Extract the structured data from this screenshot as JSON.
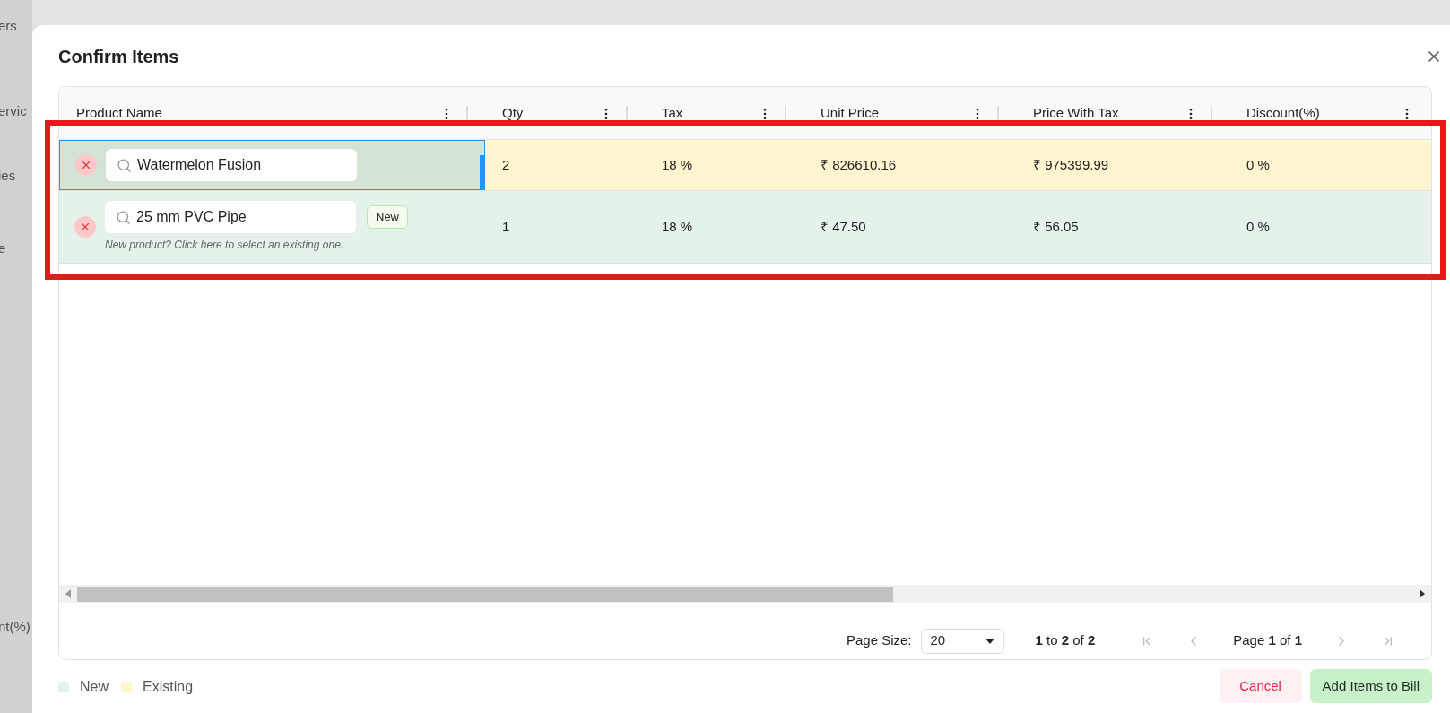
{
  "background": {
    "texts": [
      "ers",
      "ervic",
      "ies",
      "e",
      "nt(%)"
    ]
  },
  "dialog": {
    "title": "Confirm Items"
  },
  "table": {
    "columns": [
      "Product Name",
      "Qty",
      "Tax",
      "Unit Price",
      "Price With Tax",
      "Discount(%)"
    ],
    "rows": [
      {
        "kind": "existing",
        "focused": true,
        "product": "Watermelon Fusion",
        "qty": "2",
        "tax": "18 %",
        "unit_price": "₹ 826610.16",
        "price_with_tax": "₹ 975399.99",
        "discount": "0 %"
      },
      {
        "kind": "new",
        "focused": false,
        "product": "25 mm PVC Pipe",
        "badge": "New",
        "hint": "New product? Click here to select an existing one.",
        "qty": "1",
        "tax": "18 %",
        "unit_price": "₹ 47.50",
        "price_with_tax": "₹ 56.05",
        "discount": "0 %"
      }
    ]
  },
  "pagination": {
    "page_size_label": "Page Size:",
    "page_size": "20",
    "range": "**1** to **2** of **2**",
    "page": "Page **1** of **1**"
  },
  "legend": [
    {
      "kind": "new",
      "label": "New"
    },
    {
      "kind": "existing",
      "label": "Existing"
    }
  ],
  "buttons": [
    {
      "kind": "cancel",
      "label": "Cancel"
    },
    {
      "kind": "primary",
      "label": "Add Items to Bill"
    }
  ]
}
